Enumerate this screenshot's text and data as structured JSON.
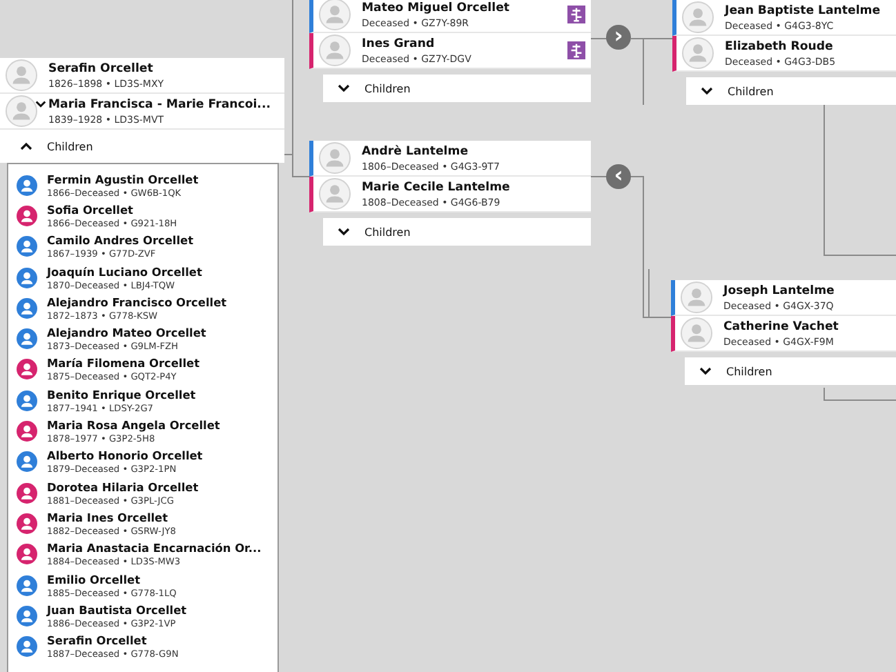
{
  "couples": [
    {
      "kind": "root",
      "expanded": true,
      "children_label": "Children",
      "members": [
        {
          "name": "Serafin Orcellet",
          "detail": "1826–1898 • LD3S-MXY",
          "selected": false,
          "record": false
        },
        {
          "name": "Maria Francisca - Marie Francoi...",
          "detail": "1839–1928 • LD3S-MVT",
          "selected": true,
          "record": false
        }
      ]
    },
    {
      "kind": "ancestor",
      "expanded": false,
      "children_label": "Children",
      "nav": "›",
      "members": [
        {
          "name": "Mateo Miguel Orcellet",
          "detail": "Deceased • GZ7Y-89R",
          "kind": "male",
          "selected": false,
          "record": true
        },
        {
          "name": "Ines Grand",
          "detail": "Deceased • GZ7Y-DGV",
          "kind": "female",
          "selected": false,
          "record": true
        }
      ]
    },
    {
      "kind": "ancestor",
      "expanded": false,
      "children_label": "Children",
      "members": [
        {
          "name": "Jean Baptiste Lantelme",
          "detail": "Deceased • G4G3-8YC",
          "kind": "male",
          "selected": false,
          "record": false
        },
        {
          "name": "Elizabeth Roude",
          "detail": "Deceased • G4G3-DB5",
          "kind": "female",
          "selected": false,
          "record": false
        }
      ]
    },
    {
      "kind": "ancestor",
      "expanded": false,
      "children_label": "Children",
      "nav": "‹",
      "members": [
        {
          "name": "Andrè Lantelme",
          "detail": "1806–Deceased • G4G3-9T7",
          "kind": "male",
          "selected": false,
          "record": false
        },
        {
          "name": "Marie Cecile Lantelme",
          "detail": "1808–Deceased • G4G6-B79",
          "kind": "female",
          "selected": false,
          "record": false
        }
      ]
    },
    {
      "kind": "ancestor",
      "expanded": false,
      "children_label": "Children",
      "members": [
        {
          "name": "Joseph Lantelme",
          "detail": "Deceased • G4GX-37Q",
          "kind": "male",
          "selected": false,
          "record": false
        },
        {
          "name": "Catherine Vachet",
          "detail": "Deceased • G4GX-F9M",
          "kind": "female",
          "selected": false,
          "record": false
        }
      ]
    }
  ],
  "children": [
    {
      "name": "Fermin Agustin Orcellet",
      "detail": "1866–Deceased • GW6B-1QK",
      "kind": "male"
    },
    {
      "name": "Sofia Orcellet",
      "detail": "1866–Deceased • G921-18H",
      "kind": "female"
    },
    {
      "name": "Camilo Andres Orcellet",
      "detail": "1867–1939 • G77D-ZVF",
      "kind": "male"
    },
    {
      "name": "Joaquín Luciano Orcellet",
      "detail": "1870–Deceased • LBJ4-TQW",
      "kind": "male"
    },
    {
      "name": "Alejandro Francisco Orcellet",
      "detail": "1872–1873 • G778-KSW",
      "kind": "male"
    },
    {
      "name": "Alejandro Mateo Orcellet",
      "detail": "1873–Deceased • G9LM-FZH",
      "kind": "male"
    },
    {
      "name": "María Filomena Orcellet",
      "detail": "1875–Deceased • GQT2-P4Y",
      "kind": "female"
    },
    {
      "name": "Benito Enrique Orcellet",
      "detail": "1877–1941 • LDSY-2G7",
      "kind": "male"
    },
    {
      "name": "Maria Rosa Angela Orcellet",
      "detail": "1878–1977 • G3P2-5H8",
      "kind": "female"
    },
    {
      "name": "Alberto Honorio Orcellet",
      "detail": "1879–Deceased • G3P2-1PN",
      "kind": "male"
    },
    {
      "name": "Dorotea Hilaria Orcellet",
      "detail": "1881–Deceased • G3PL-JCG",
      "kind": "female"
    },
    {
      "name": "Maria Ines Orcellet",
      "detail": "1882–Deceased • GSRW-JY8",
      "kind": "female"
    },
    {
      "name": "Maria Anastacia Encarnación Or...",
      "detail": "1884–Deceased • LD3S-MW3",
      "kind": "female"
    },
    {
      "name": "Emilio Orcellet",
      "detail": "1885–Deceased • G778-1LQ",
      "kind": "male"
    },
    {
      "name": "Juan Bautista Orcellet",
      "detail": "1886–Deceased • G3P2-1VP",
      "kind": "male"
    },
    {
      "name": "Serafin Orcellet",
      "detail": "1887–Deceased • G778-G9N",
      "kind": "male"
    }
  ]
}
